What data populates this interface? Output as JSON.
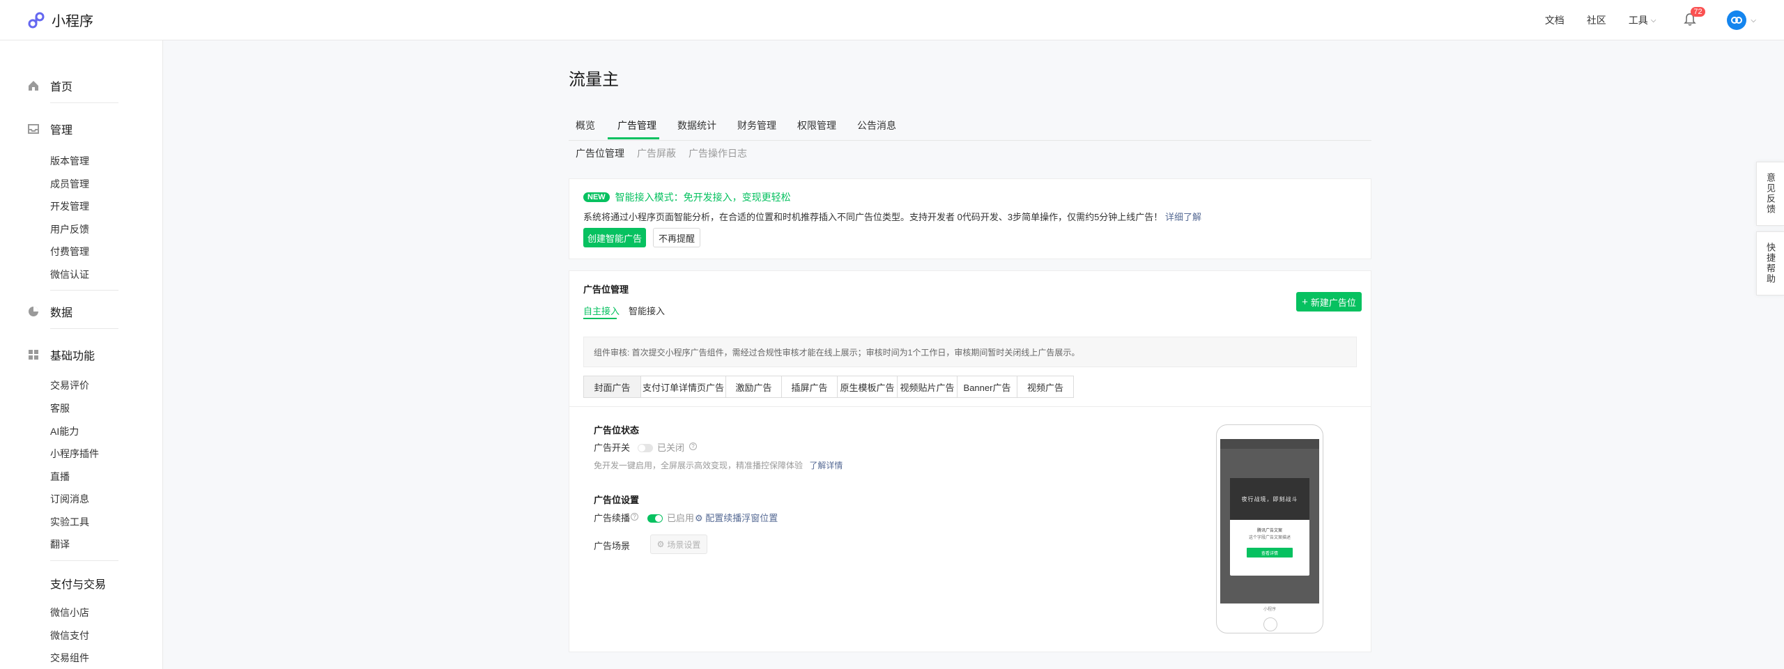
{
  "brand": {
    "name": "小程序"
  },
  "topnav": {
    "docs": "文档",
    "community": "社区",
    "tools": "工具",
    "badge": "72"
  },
  "sidebar": {
    "home": "首页",
    "manage": {
      "title": "管理",
      "items": [
        "版本管理",
        "成员管理",
        "开发管理",
        "用户反馈",
        "付费管理",
        "微信认证"
      ]
    },
    "data": "数据",
    "basic": {
      "title": "基础功能",
      "items": [
        "交易评价",
        "客服",
        "AI能力",
        "小程序插件",
        "直播",
        "订阅消息",
        "实验工具",
        "翻译"
      ]
    },
    "pay": {
      "title": "支付与交易",
      "items": [
        "微信小店",
        "微信支付",
        "交易组件"
      ]
    }
  },
  "float": {
    "feedback": "意见反馈",
    "help": "快捷帮助"
  },
  "page": {
    "title": "流量主",
    "tabs": [
      "概览",
      "广告管理",
      "数据统计",
      "财务管理",
      "权限管理",
      "公告消息"
    ],
    "subtabs": [
      "广告位管理",
      "广告屏蔽",
      "广告操作日志"
    ]
  },
  "promo": {
    "badge": "NEW",
    "title": "智能接入模式：免开发接入，变现更轻松",
    "desc": "系统将通过小程序页面智能分析，在合适的位置和时机推荐插入不同广告位类型。支持开发者 0代码开发、3步简单操作，仅需约5分钟上线广告！",
    "link": "详细了解",
    "create_btn": "创建智能广告",
    "dismiss_btn": "不再提醒"
  },
  "adpos": {
    "title": "广告位管理",
    "tabs": [
      "自主接入",
      "智能接入"
    ],
    "new_btn": "新建广告位",
    "notice": "组件审核: 首次提交小程序广告组件，需经过合规性审核才能在线上展示；审核时间为1个工作日，审核期间暂时关闭线上广告展示。",
    "types": [
      "封面广告",
      "支付订单详情页广告",
      "激励广告",
      "插屏广告",
      "原生模板广告",
      "视频贴片广告",
      "Banner广告",
      "视频广告"
    ],
    "status_title": "广告位状态",
    "switch_label": "广告开关",
    "switch_state": "已关闭",
    "desc": "免开发一键启用，全屏展示高效变现，精准播控保障体验",
    "learn_more": "了解详情",
    "settings_title": "广告位设置",
    "sticky_label": "广告续播",
    "sticky_state": "已启用",
    "sticky_link": "配置续播浮窗位置",
    "scene_label": "广告场景",
    "scene_btn": "场景设置"
  },
  "phone": {
    "ad_image_text": "夜行战境，即刻战斗",
    "ad_line1": "腾讯广告文案",
    "ad_line2": "这个字段广告文案描述",
    "ad_button": "查看详情",
    "bottom_text": "小程序"
  }
}
